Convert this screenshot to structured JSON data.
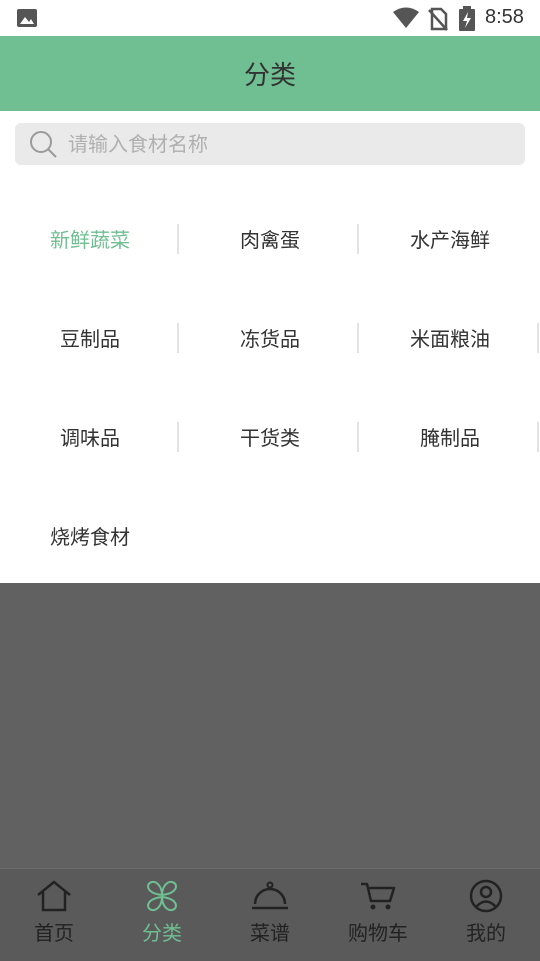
{
  "status_bar": {
    "time": "8:58",
    "icons": [
      "gallery-icon",
      "wifi-icon",
      "no-sim-icon",
      "battery-charging-icon"
    ]
  },
  "header": {
    "title": "分类"
  },
  "search": {
    "placeholder": "请输入食材名称",
    "value": ""
  },
  "categories": {
    "active": "新鲜蔬菜",
    "active_color": "#6fbf92",
    "items": [
      "新鲜蔬菜",
      "肉禽蛋",
      "水产海鲜",
      "豆制品",
      "冻货品",
      "米面粮油",
      "调味品",
      "干货类",
      "腌制品",
      "烧烤食材"
    ]
  },
  "tabbar": {
    "active_index": 1,
    "tabs": [
      {
        "label": "首页",
        "icon": "home-icon"
      },
      {
        "label": "分类",
        "icon": "category-icon"
      },
      {
        "label": "菜谱",
        "icon": "recipe-cloche-icon"
      },
      {
        "label": "购物车",
        "icon": "cart-icon"
      },
      {
        "label": "我的",
        "icon": "profile-icon"
      }
    ]
  },
  "colors": {
    "accent": "#6fbf92",
    "overlay": "#616161"
  }
}
